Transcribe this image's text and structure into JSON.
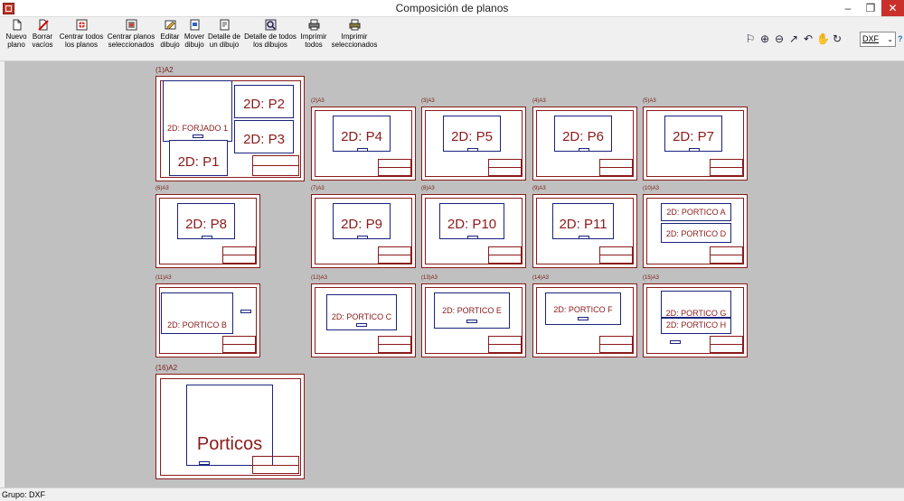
{
  "window": {
    "title": "Composición de planos",
    "minimize": "–",
    "maximize": "❐",
    "close": "✕"
  },
  "toolbar": {
    "buttons": [
      {
        "line1": "Nuevo",
        "line2": "plano",
        "icon": "new-page-icon"
      },
      {
        "line1": "Borrar",
        "line2": "vacíos",
        "icon": "erase-icon"
      },
      {
        "line1": "Centrar todos",
        "line2": "los planos",
        "icon": "center-all-icon"
      },
      {
        "line1": "Centrar planos",
        "line2": "seleccionados",
        "icon": "center-selected-icon"
      },
      {
        "line1": "Editar",
        "line2": "dibujo",
        "icon": "edit-drawing-icon"
      },
      {
        "line1": "Mover",
        "line2": "dibujo",
        "icon": "move-drawing-icon"
      },
      {
        "line1": "Detalle de",
        "line2": "un dibujo",
        "icon": "detail-one-icon"
      },
      {
        "line1": "Detalle de todos",
        "line2": "los dibujos",
        "icon": "detail-all-icon"
      },
      {
        "line1": "Imprimir",
        "line2": "todos",
        "icon": "print-all-icon"
      },
      {
        "line1": "Imprimir",
        "line2": "seleccionados",
        "icon": "print-selected-icon"
      }
    ],
    "right_icons": [
      "zoom-window-icon",
      "zoom-in-icon",
      "zoom-out-icon",
      "zoom-extents-icon",
      "zoom-previous-icon",
      "pan-icon",
      "refresh-icon"
    ],
    "format": {
      "value": "DXF",
      "arrow": "⌄"
    },
    "help": "?"
  },
  "sheets": [
    {
      "label": "(1)A2"
    },
    {
      "label": "(2)A3"
    },
    {
      "label": "(3)A3"
    },
    {
      "label": "(4)A3"
    },
    {
      "label": "(5)A3"
    },
    {
      "label": "(6)A3"
    },
    {
      "label": "(7)A3"
    },
    {
      "label": "(8)A3"
    },
    {
      "label": "(9)A3"
    },
    {
      "label": "(10)A3"
    },
    {
      "label": "(11)A3"
    },
    {
      "label": "(12)A3"
    },
    {
      "label": "(13)A3"
    },
    {
      "label": "(14)A3"
    },
    {
      "label": "(15)A3"
    },
    {
      "label": "(16)A2"
    }
  ],
  "drawings": {
    "forjado": "2D: FORJADO 1",
    "p1": "2D: P1",
    "p2": "2D: P2",
    "p3": "2D: P3",
    "p4": "2D: P4",
    "p5": "2D: P5",
    "p6": "2D: P6",
    "p7": "2D: P7",
    "p8": "2D: P8",
    "p9": "2D: P9",
    "p10": "2D: P10",
    "p11": "2D: P11",
    "porticoA": "2D: PORTICO A",
    "porticoD": "2D: PORTICO D",
    "porticoB": "2D: PORTICO B",
    "porticoC": "2D: PORTICO C",
    "porticoE": "2D: PORTICO E",
    "porticoF": "2D: PORTICO F",
    "porticoG": "2D: PORTICO G",
    "porticoH": "2D: PORTICO H",
    "porticos": "Porticos"
  },
  "status": {
    "text": "Grupo: DXF"
  }
}
